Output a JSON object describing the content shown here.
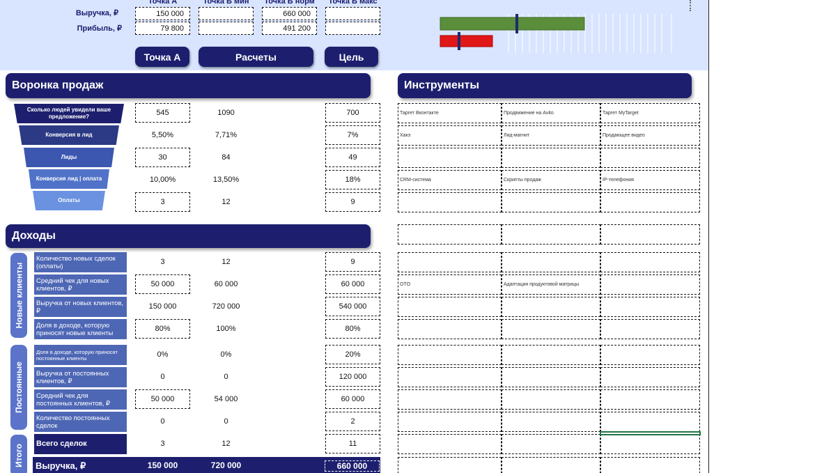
{
  "top": {
    "col_headers": [
      "Точка А",
      "Точка Б мин",
      "Точка Б норм",
      "Точка Б макс"
    ],
    "rows": [
      {
        "label": "Выручка, ₽",
        "values": [
          "150 000",
          "",
          "660 000",
          ""
        ]
      },
      {
        "label": "Прибыль, ₽",
        "values": [
          "79 800",
          "",
          "491 200",
          ""
        ]
      }
    ],
    "buttons": {
      "point_a": "Точка А",
      "calc": "Расчеты",
      "goal": "Цель"
    }
  },
  "progress": {
    "green_fill": 0.75,
    "red_fill": 0.27,
    "colors": {
      "green": "#5a8e3a",
      "red": "#e01818"
    }
  },
  "funnel": {
    "title": "Воронка продаж",
    "stages": [
      {
        "label": "Сколько людей увидели ваше предложение?",
        "a": "545",
        "b": "1090",
        "c": "700"
      },
      {
        "label": "Конверсия в лид",
        "a": "5,50%",
        "b": "7,71%",
        "c": "7%"
      },
      {
        "label": "Лиды",
        "a": "30",
        "b": "84",
        "c": "49"
      },
      {
        "label": "Конверсия лид | оплата",
        "a": "10,00%",
        "b": "13,50%",
        "c": "18%"
      },
      {
        "label": "Оплаты",
        "a": "3",
        "b": "12",
        "c": "9"
      }
    ]
  },
  "tools": {
    "title": "Инструменты",
    "rows": [
      [
        "Таргет Вконтакте",
        "Продвижение на Avito",
        "Таргет MyTarget"
      ],
      [
        "Хакэ",
        "Лид-магнит",
        "Продающее видео"
      ],
      [
        "",
        "",
        ""
      ],
      [
        "CRM-система",
        "Скрипты продаж",
        "IP-телефония"
      ],
      [
        "",
        "",
        ""
      ],
      [
        "",
        "",
        ""
      ],
      [
        "",
        "",
        ""
      ],
      [
        "OTO",
        "Адаптация продуктовой матрицы",
        ""
      ],
      [
        "",
        "",
        ""
      ],
      [
        "",
        "",
        ""
      ],
      [
        "",
        "",
        ""
      ],
      [
        "",
        "",
        ""
      ],
      [
        "",
        "",
        ""
      ],
      [
        "",
        "",
        ""
      ],
      [
        "",
        "",
        ""
      ],
      [
        "",
        "",
        ""
      ]
    ]
  },
  "income": {
    "title": "Доходы",
    "new_clients_caption": "Новые клиенты",
    "regular_caption": "Постоянные",
    "total_caption": "Итого",
    "new_clients": [
      {
        "label": "Количество новых сделок (оплаты)",
        "a": "3",
        "b": "12",
        "c": "9"
      },
      {
        "label": "Средний чек для новых клиентов, ₽",
        "a": "50 000",
        "b": "60 000",
        "c": "60 000"
      },
      {
        "label": "Выручка от новых клиентов, ₽",
        "a": "150 000",
        "b": "720 000",
        "c": "540 000"
      },
      {
        "label": "Доля в доходе, которую приносят новые клиенты",
        "a": "80%",
        "b": "100%",
        "c": "80%"
      }
    ],
    "regular": [
      {
        "label": "Доля в доходе, которую приносят постоянные клиенты",
        "a": "0%",
        "b": "0%",
        "c": "20%"
      },
      {
        "label": "Выручка от постоянных клиентов, ₽",
        "a": "0",
        "b": "0",
        "c": "120 000"
      },
      {
        "label": "Средний чек для постоянных клиентов, ₽",
        "a": "50 000",
        "b": "54 000",
        "c": "60 000"
      },
      {
        "label": "Количество постоянных сделок",
        "a": "0",
        "b": "0",
        "c": "2"
      }
    ],
    "total_deals": {
      "label": "Всего сделок",
      "a": "3",
      "b": "12",
      "c": "11"
    },
    "total_revenue": {
      "label": "Выручка, ₽",
      "a": "150 000",
      "b": "720 000",
      "c": "660 000"
    }
  }
}
